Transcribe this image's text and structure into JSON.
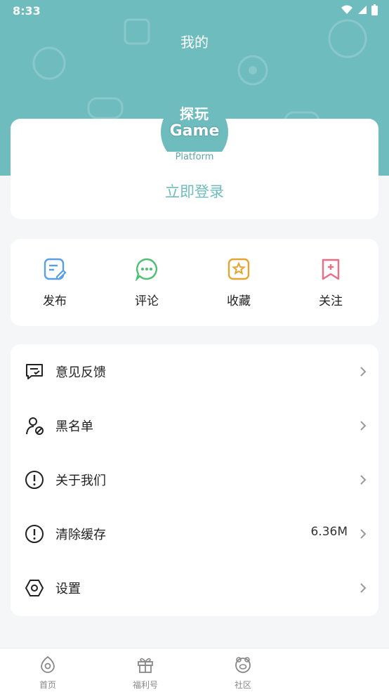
{
  "status_bar": {
    "time": "8:33"
  },
  "header": {
    "title": "我的"
  },
  "profile": {
    "logo_line1": "探玩",
    "logo_line2": "Game",
    "logo_sub": "Platform",
    "login_label": "立即登录"
  },
  "actions": [
    {
      "label": "发布",
      "icon": "edit-icon",
      "color": "#5b9ee8"
    },
    {
      "label": "评论",
      "icon": "comment-icon",
      "color": "#4fbf73"
    },
    {
      "label": "收藏",
      "icon": "star-icon",
      "color": "#e6a531"
    },
    {
      "label": "关注",
      "icon": "bookmark-plus-icon",
      "color": "#ee6d86"
    }
  ],
  "menu": [
    {
      "label": "意见反馈",
      "icon": "feedback-icon",
      "value": ""
    },
    {
      "label": "黑名单",
      "icon": "blacklist-user-icon",
      "value": ""
    },
    {
      "label": "关于我们",
      "icon": "info-icon",
      "value": ""
    },
    {
      "label": "清除缓存",
      "icon": "info-icon",
      "value": "6.36M"
    },
    {
      "label": "设置",
      "icon": "settings-icon",
      "value": ""
    }
  ],
  "tabbar": [
    {
      "label": "首页",
      "icon": "home-icon"
    },
    {
      "label": "福利号",
      "icon": "gift-icon"
    },
    {
      "label": "社区",
      "icon": "community-icon"
    }
  ],
  "colors": {
    "accent": "#6fbcbf",
    "background": "#f5f6f8"
  }
}
